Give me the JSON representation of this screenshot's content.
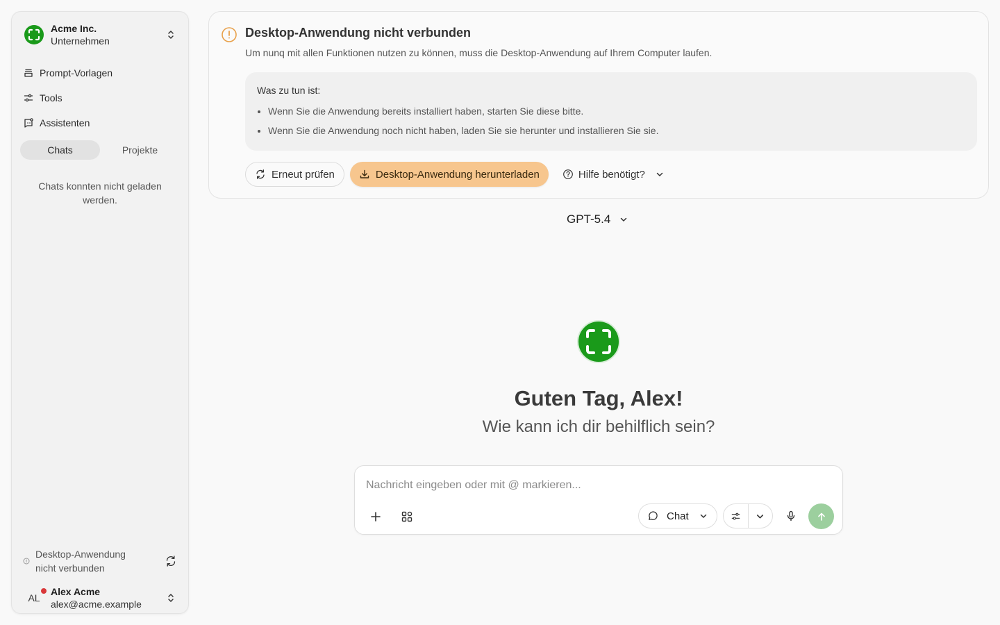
{
  "colors": {
    "brand_green": "#1a9a1a",
    "warning_orange": "#e8a04a",
    "download_button": "#f7c68e",
    "send_button": "#9ccf9e",
    "status_dot": "#d9383a"
  },
  "sidebar": {
    "org": {
      "name": "Acme Inc.",
      "type": "Unternehmen",
      "logo_icon": "acme-logo-icon"
    },
    "nav": [
      {
        "label": "Prompt-Vorlagen",
        "icon": "prompt-templates-icon"
      },
      {
        "label": "Tools",
        "icon": "tools-icon"
      },
      {
        "label": "Assistenten",
        "icon": "assistants-icon"
      }
    ],
    "tabs": [
      {
        "label": "Chats",
        "active": true
      },
      {
        "label": "Projekte",
        "active": false
      }
    ],
    "chats_error": "Chats konnten nicht geladen werden.",
    "desktop_status": "Desktop-Anwendung nicht verbunden",
    "user": {
      "initials": "AL",
      "name": "Alex Acme",
      "email": "alex@acme.example"
    }
  },
  "banner": {
    "title": "Desktop-Anwendung nicht verbunden",
    "description": "Um nunq mit allen Funktionen nutzen zu können, muss die Desktop-Anwendung auf Ihrem Computer laufen.",
    "todo_title": "Was zu tun ist:",
    "todo_items": [
      "Wenn Sie die Anwendung bereits installiert haben, starten Sie diese bitte.",
      "Wenn Sie die Anwendung noch nicht haben, laden Sie sie herunter und installieren Sie sie."
    ],
    "retry_label": "Erneut prüfen",
    "download_label": "Desktop-Anwendung herunterladen",
    "help_label": "Hilfe benötigt?"
  },
  "model": {
    "selected": "GPT-5.4"
  },
  "hero": {
    "greeting": "Guten Tag, Alex!",
    "subgreeting": "Wie kann ich dir behilflich sein?"
  },
  "composer": {
    "placeholder": "Nachricht eingeben oder mit @ markieren...",
    "value": "",
    "mode_label": "Chat"
  }
}
